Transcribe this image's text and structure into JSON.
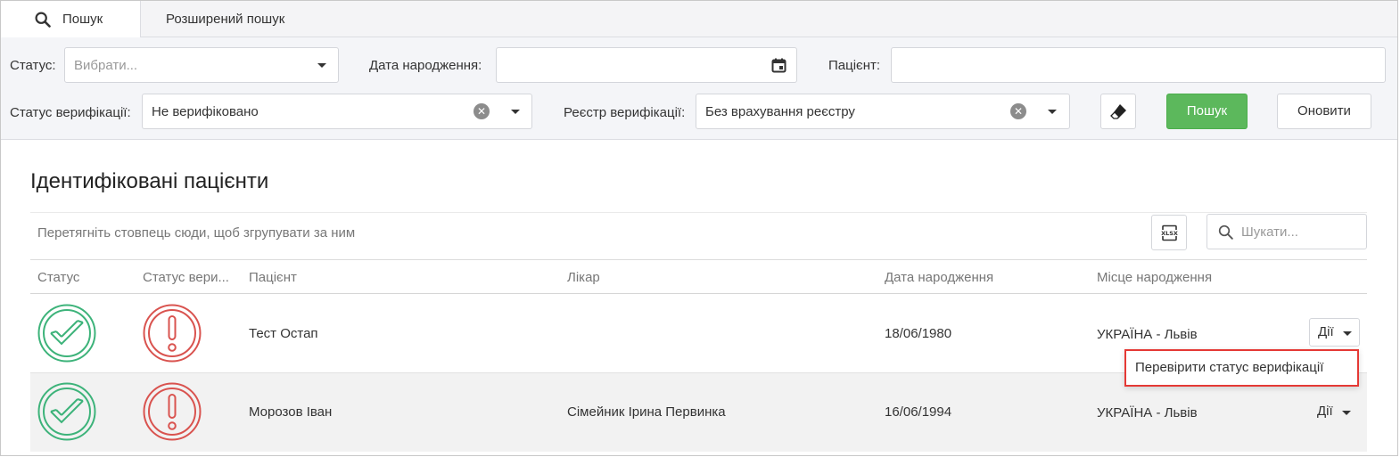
{
  "tabs": [
    {
      "label": "Пошук",
      "icon": "search-icon",
      "active": true
    },
    {
      "label": "Розширений пошук",
      "active": false
    }
  ],
  "filters": {
    "status_label": "Статус:",
    "status_placeholder": "Вибрати...",
    "birthdate_label": "Дата народження:",
    "birthdate_value": "",
    "patient_label": "Пацієнт:",
    "patient_value": "",
    "verif_status_label": "Статус верифікації:",
    "verif_status_value": "Не верифіковано",
    "verif_registry_label": "Реєстр верифікації:",
    "verif_registry_value": "Без врахування реєстру",
    "search_button": "Пошук",
    "refresh_button": "Оновити"
  },
  "grid": {
    "title": "Ідентифіковані пацієнти",
    "group_hint": "Перетягніть стовпець сюди, щоб згрупувати за ним",
    "search_placeholder": "Шукати...",
    "columns": [
      "Статус",
      "Статус вери...",
      "Пацієнт",
      "Лікар",
      "Дата народження",
      "Місце народження"
    ],
    "rows": [
      {
        "status": "verified",
        "verif_status": "warning",
        "patient": "Тест Остап",
        "doctor": "",
        "birthdate": "18/06/1980",
        "birthplace": "УКРАЇНА - Львів",
        "actions": "Дії"
      },
      {
        "status": "verified",
        "verif_status": "warning",
        "patient": "Морозов Іван",
        "doctor": "Сімейник Ірина Первинка",
        "birthdate": "16/06/1994",
        "birthplace": "УКРАЇНА - Львів",
        "actions": "Дії"
      }
    ],
    "dropdown_item": "Перевірити статус верифікації"
  },
  "colors": {
    "ok": "#3db37a",
    "warning": "#d9534f",
    "primary_button": "#5cb85c",
    "highlight_border": "#e53935"
  }
}
